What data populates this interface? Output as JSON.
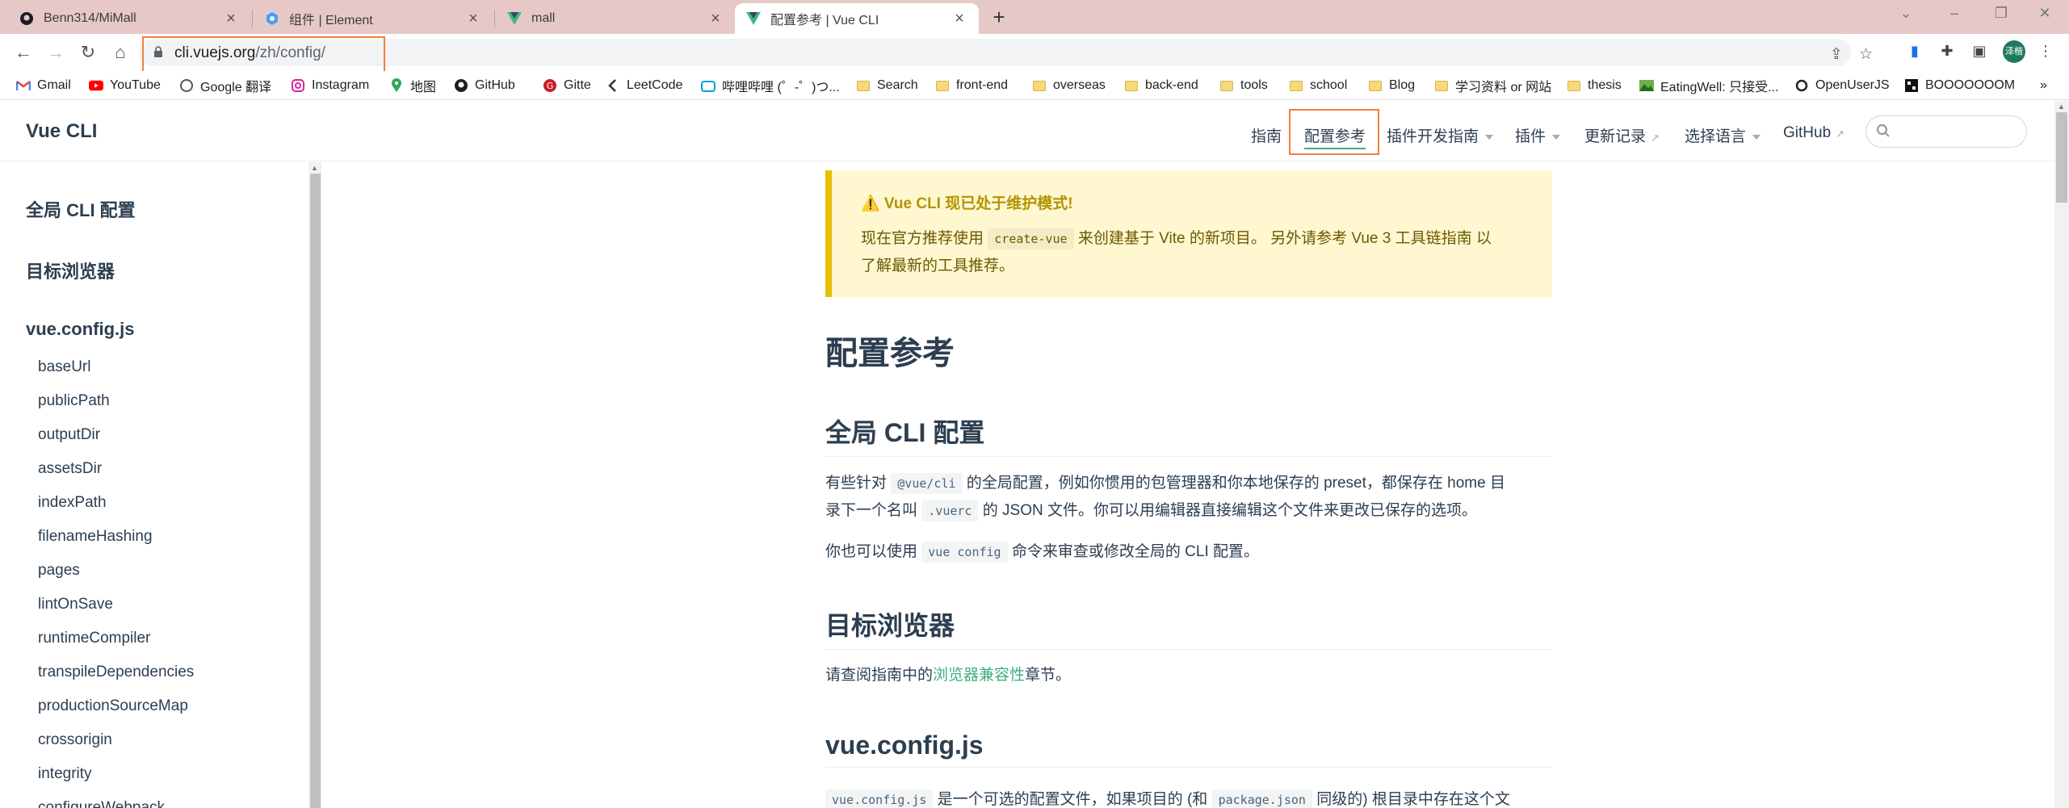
{
  "browser": {
    "tabs": [
      {
        "title": "Benn314/MiMall",
        "icon": "github-icon"
      },
      {
        "title": "组件 | Element",
        "icon": "element-icon"
      },
      {
        "title": "mall",
        "icon": "vue-icon"
      },
      {
        "title": "配置参考 | Vue CLI",
        "icon": "vue-icon",
        "active": true
      }
    ],
    "url_host": "cli.vuejs.org",
    "url_path": "/zh/config/",
    "profile_label": "泽楷",
    "bookmarks": [
      {
        "label": "Gmail",
        "icon": "gmail-icon"
      },
      {
        "label": "YouTube",
        "icon": "youtube-icon"
      },
      {
        "label": "Google 翻译",
        "icon": "translate-icon"
      },
      {
        "label": "Instagram",
        "icon": "instagram-icon"
      },
      {
        "label": "地图",
        "icon": "maps-icon"
      },
      {
        "label": "GitHub",
        "icon": "github-icon"
      },
      {
        "label": "Gitte",
        "icon": "gitee-icon"
      },
      {
        "label": "LeetCode",
        "icon": "leetcode-icon"
      },
      {
        "label": "哔哩哔哩 (゜-゜)つ...",
        "icon": "bilibili-icon"
      },
      {
        "label": "Search",
        "icon": "folder-icon"
      },
      {
        "label": "front-end",
        "icon": "folder-icon"
      },
      {
        "label": "overseas",
        "icon": "folder-icon"
      },
      {
        "label": "back-end",
        "icon": "folder-icon"
      },
      {
        "label": "tools",
        "icon": "folder-icon"
      },
      {
        "label": "school",
        "icon": "folder-icon"
      },
      {
        "label": "Blog",
        "icon": "folder-icon"
      },
      {
        "label": "学习资料 or 网站",
        "icon": "folder-icon"
      },
      {
        "label": "thesis",
        "icon": "folder-icon"
      },
      {
        "label": "EatingWell: 只接受...",
        "icon": "eatingwell-icon"
      },
      {
        "label": "OpenUserJS",
        "icon": "openuserjs-icon"
      },
      {
        "label": "BOOOOOOOM",
        "icon": "boooooom-icon"
      }
    ],
    "bookmarks_more": "»"
  },
  "site": {
    "brand": "Vue CLI",
    "nav": [
      {
        "label": "指南"
      },
      {
        "label": "配置参考",
        "active": true
      },
      {
        "label": "插件开发指南",
        "dropdown": true
      },
      {
        "label": "插件",
        "dropdown": true
      },
      {
        "label": "更新记录",
        "external": true
      },
      {
        "label": "选择语言",
        "dropdown": true
      },
      {
        "label": "GitHub",
        "external": true
      }
    ],
    "search_placeholder": ""
  },
  "sidebar": {
    "headings": [
      "全局 CLI 配置",
      "目标浏览器",
      "vue.config.js"
    ],
    "items": [
      "baseUrl",
      "publicPath",
      "outputDir",
      "assetsDir",
      "indexPath",
      "filenameHashing",
      "pages",
      "lintOnSave",
      "runtimeCompiler",
      "transpileDependencies",
      "productionSourceMap",
      "crossorigin",
      "integrity",
      "configureWebpack"
    ]
  },
  "content": {
    "tip": {
      "title": "⚠️ Vue CLI 现已处于维护模式!",
      "line1_pre": "现在官方推荐使用 ",
      "line1_code": "create-vue",
      "line1_post": " 来创建基于 Vite 的新项目。 另外请参考 Vue 3 工具链指南 以",
      "line2": "了解最新的工具推荐。"
    },
    "title": "配置参考",
    "sections": [
      {
        "heading": "全局 CLI 配置",
        "p1_a": "有些针对 ",
        "p1_code1": "@vue/cli",
        "p1_b": " 的全局配置，例如你惯用的包管理器和你本地保存的 preset，都保存在 home 目",
        "p1_c": "录下一个名叫 ",
        "p1_code2": ".vuerc",
        "p1_d": " 的 JSON 文件。你可以用编辑器直接编辑这个文件来更改已保存的选项。",
        "p2_a": "你也可以使用 ",
        "p2_code": "vue config",
        "p2_b": " 命令来审查或修改全局的 CLI 配置。"
      },
      {
        "heading": "目标浏览器",
        "p1_a": "请查阅指南中的",
        "p1_link": "浏览器兼容性",
        "p1_b": "章节。"
      },
      {
        "heading": "vue.config.js",
        "p1_code1": "vue.config.js",
        "p1_a": " 是一个可选的配置文件，如果项目的 (和 ",
        "p1_code2": "package.json",
        "p1_b": " 同级的) 根目录中存在这个文"
      }
    ]
  },
  "colors": {
    "accent": "#3eaf7c",
    "highlight_box": "#f0803c",
    "tab_bar": "#e6c9c6",
    "tip_bg": "#fff7d0",
    "tip_border": "#e7c000"
  }
}
